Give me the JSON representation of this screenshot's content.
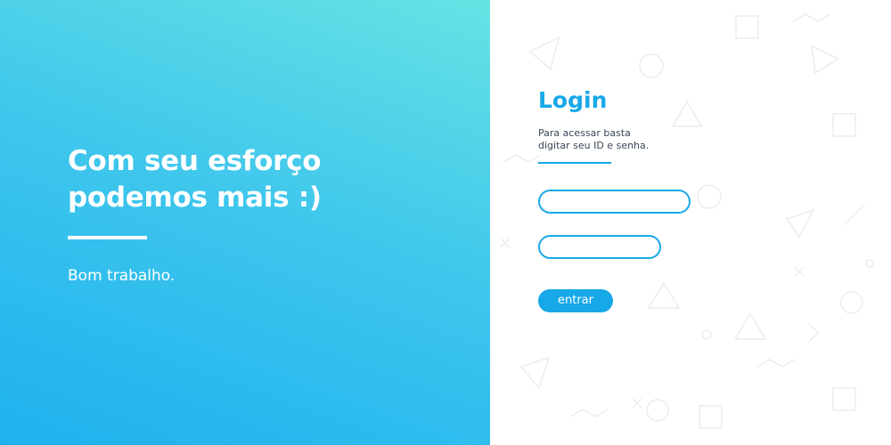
{
  "hero": {
    "title": "Com seu esforço\npodemos mais :)",
    "subtitle": "Bom trabalho."
  },
  "login": {
    "title": "Login",
    "description": "Para acessar basta\ndigitar seu ID e senha.",
    "id_field": {
      "value": "",
      "placeholder": ""
    },
    "password_field": {
      "value": "",
      "placeholder": ""
    },
    "submit_label": "entrar"
  },
  "colors": {
    "accent": "#17a8e8",
    "hero_gradient_top": "#66e3e4",
    "hero_gradient_bottom": "#1eb1ef",
    "panel_background": "#ffffff",
    "pattern": "#e9edf2"
  }
}
